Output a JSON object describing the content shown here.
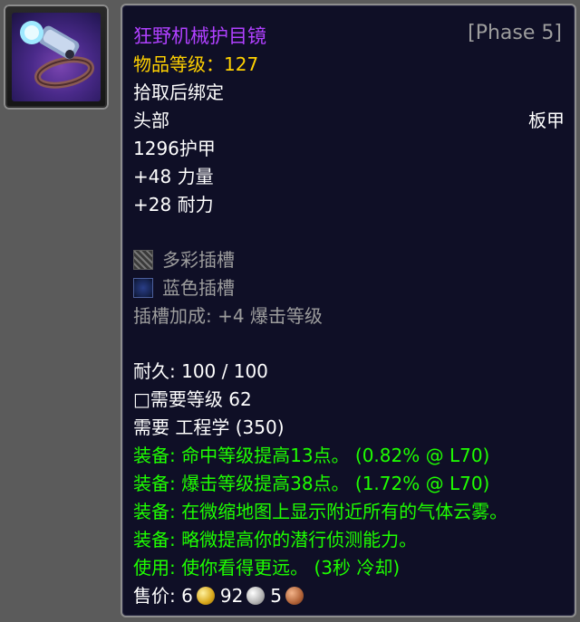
{
  "item": {
    "name": "狂野机械护目镜",
    "phase": "[Phase 5]",
    "item_level_label": "物品等级：",
    "item_level_value": "127",
    "bind": "拾取后绑定",
    "slot": "头部",
    "armor_type": "板甲",
    "armor": "1296护甲",
    "stats": [
      "+48 力量",
      "+28 耐力"
    ],
    "sockets": [
      {
        "label": "多彩插槽",
        "icon": "prismatic-socket-icon"
      },
      {
        "label": "蓝色插槽",
        "icon": "blue-socket-icon"
      }
    ],
    "socket_bonus": "插槽加成: +4 爆击等级",
    "durability": "耐久: 100 / 100",
    "required_level": "□需要等级 62",
    "required_skill": "需要 工程学 (350)",
    "effects": [
      "装备: 命中等级提高13点。 (0.82% @ L70)",
      "装备: 爆击等级提高38点。 (1.72% @ L70)",
      "装备:  在微缩地图上显示附近所有的气体云雾。",
      "装备:  略微提高你的潜行侦测能力。",
      "使用: 使你看得更远。 (3秒 冷却)"
    ],
    "sell_label": "售价:",
    "sell_gold": "6",
    "sell_silver": "92",
    "sell_copper": "5"
  },
  "colors": {
    "epic_purple": "#b040ff",
    "item_level_yellow": "#ffd100",
    "effect_green": "#1eff00",
    "gray_text": "#9d9d9d",
    "tooltip_bg": "#0f0f26"
  },
  "icons": [
    "goggles-icon",
    "gold-coin-icon",
    "silver-coin-icon",
    "copper-coin-icon"
  ]
}
